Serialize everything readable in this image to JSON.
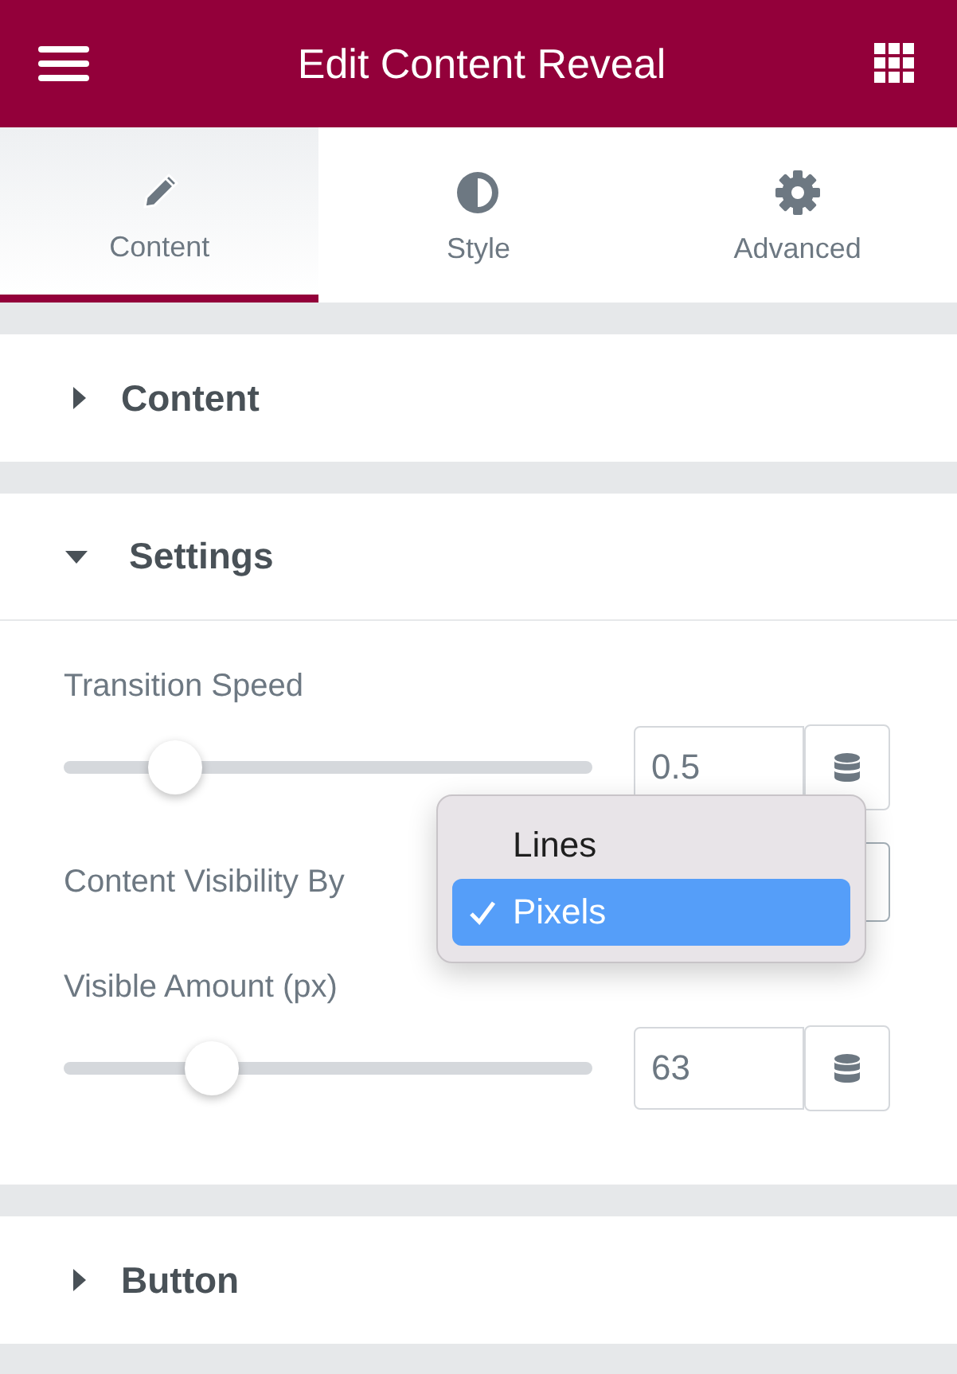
{
  "header": {
    "title": "Edit Content Reveal"
  },
  "tabs": [
    {
      "label": "Content",
      "selected": true
    },
    {
      "label": "Style",
      "selected": false
    },
    {
      "label": "Advanced",
      "selected": false
    }
  ],
  "sections": [
    {
      "title": "Content",
      "expanded": false
    },
    {
      "title": "Settings",
      "expanded": true,
      "controls": [
        {
          "kind": "slider",
          "label": "Transition Speed",
          "level": 0.21,
          "value": "0.5"
        },
        {
          "kind": "select",
          "label": "Content Visibility By",
          "options": [
            {
              "label": "Lines",
              "selected": false
            },
            {
              "label": "Pixels",
              "selected": true
            }
          ]
        },
        {
          "kind": "slider",
          "label": "Visible Amount (px)",
          "level": 0.28,
          "value": "63"
        }
      ]
    },
    {
      "title": "Button",
      "expanded": false
    }
  ]
}
